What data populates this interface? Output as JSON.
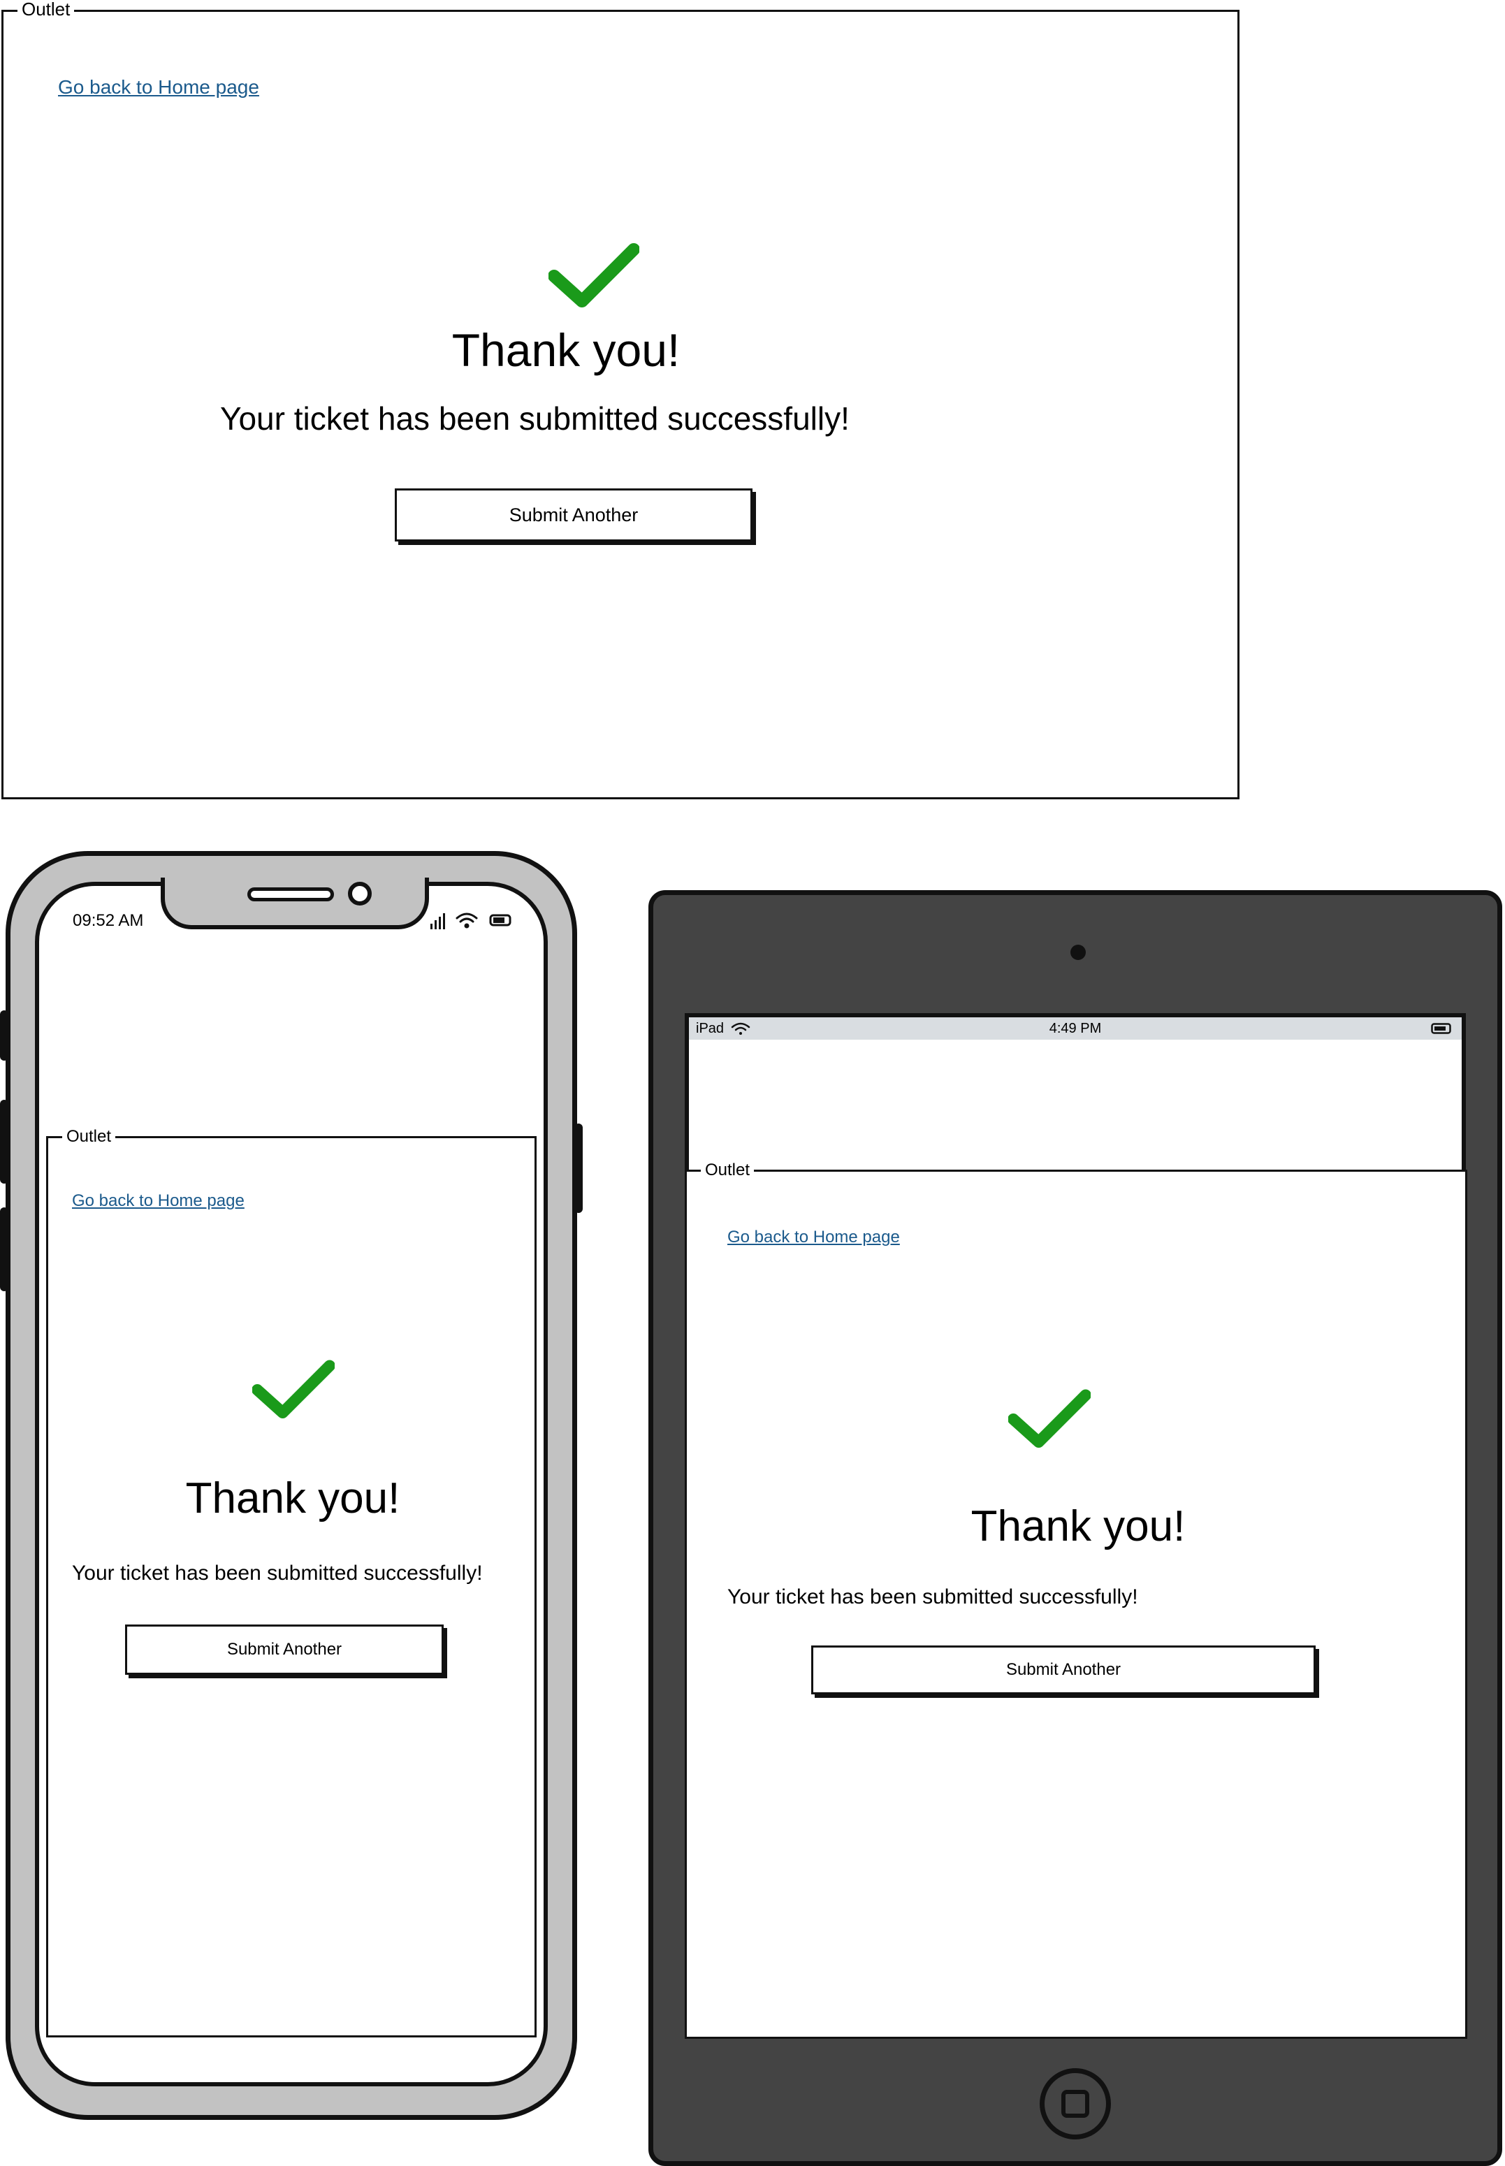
{
  "outlet_label": "Outlet",
  "home_link": "Go back to Home page",
  "heading": "Thank you!",
  "message": "Your ticket has been submitted successfully!",
  "submit_another": "Submit Another",
  "phone": {
    "time": "09:52 AM"
  },
  "tablet": {
    "device": "iPad",
    "time": "4:49 PM"
  },
  "colors": {
    "check": "#1a9a1a",
    "link": "#1b5a8c",
    "tablet_frame": "#444444",
    "phone_frame": "#c2c2c2"
  },
  "icons": [
    "checkmark-icon",
    "signal-icon",
    "wifi-icon",
    "battery-icon"
  ]
}
